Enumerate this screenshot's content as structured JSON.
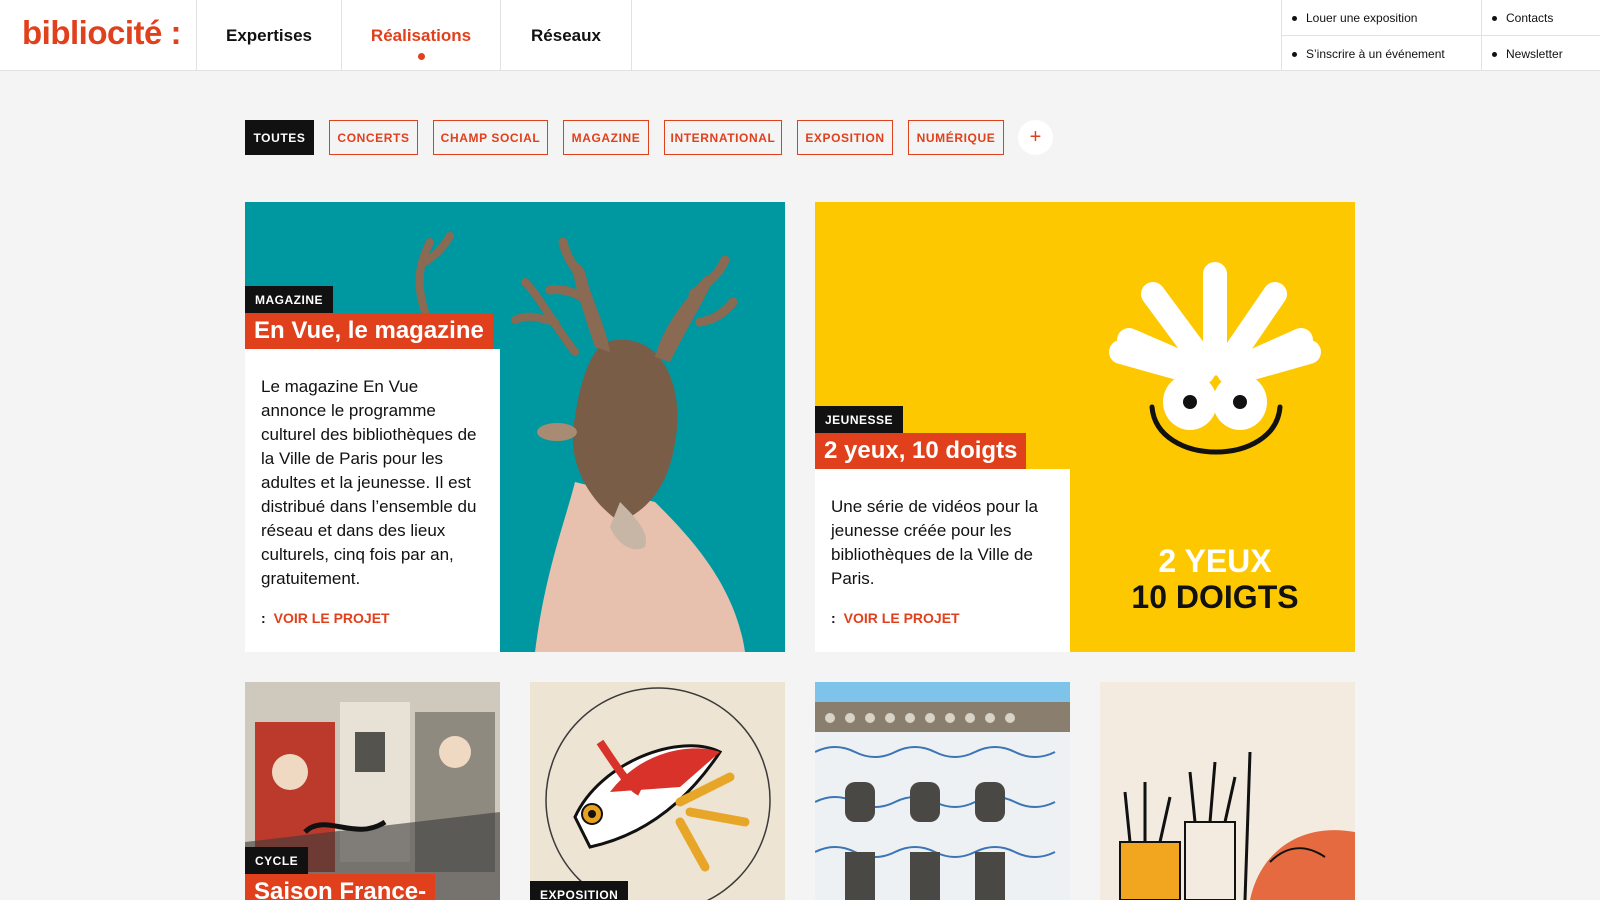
{
  "header": {
    "logo": "bibliocité :",
    "nav": [
      {
        "label": "Expertises",
        "active": false
      },
      {
        "label": "Réalisations",
        "active": true
      },
      {
        "label": "Réseaux",
        "active": false
      }
    ],
    "utility_links": [
      "Louer une exposition",
      "Contacts",
      "S’inscrire à un événement",
      "Newsletter"
    ]
  },
  "filters": [
    "TOUTES",
    "CONCERTS",
    "CHAMP SOCIAL",
    "MAGAZINE",
    "INTERNATIONAL",
    "EXPOSITION",
    "NUMÉRIQUE"
  ],
  "filters_selected": "TOUTES",
  "more_filters_label": "+",
  "featured": [
    {
      "category": "MAGAZINE",
      "title": "En Vue, le magazine",
      "description": "Le magazine En Vue annonce le programme culturel des bibliothèques de la Ville de Paris pour les adultes et la jeunesse. Il est distribué dans l’ensemble du réseau et dans des lieux culturels, cinq fois par an, gratuitement.",
      "link": "VOIR LE PROJET",
      "image": "reindeer-collage-teal"
    },
    {
      "category": "JEUNESSE",
      "title": "2 yeux, 10 doigts",
      "description": "Une série de vidéos pour la jeunesse créée pour les bibliothèques de la Ville de Paris.",
      "link": "VOIR LE PROJET",
      "image": "smiley-hand-yellow",
      "image_text": [
        "2 YEUX",
        "10 DOIGTS"
      ]
    }
  ],
  "grid": [
    {
      "category": "CYCLE",
      "title": "Saison France-",
      "image": "street-mural"
    },
    {
      "category": "EXPOSITION",
      "title": "",
      "image": "fish-illustration"
    },
    {
      "category": "",
      "title": "",
      "image": "azulejo-building"
    },
    {
      "category": "",
      "title": "",
      "image": "art-brushes"
    }
  ],
  "colors": {
    "accent": "#e0401c",
    "teal": "#0098a0",
    "yellow": "#fdc800",
    "dark": "#111111",
    "background": "#f4f4f4"
  },
  "link_prefix": ":"
}
